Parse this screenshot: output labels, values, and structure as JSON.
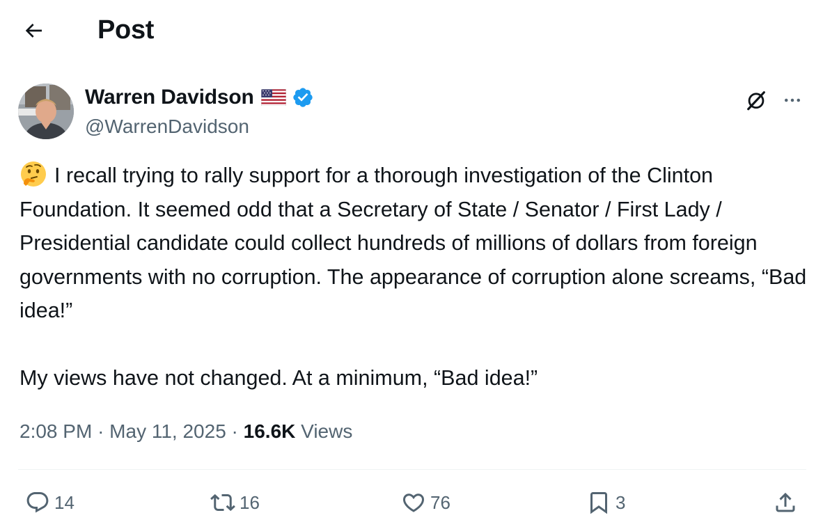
{
  "header": {
    "title": "Post",
    "back_icon": "arrow-left-icon"
  },
  "author": {
    "display_name": "Warren Davidson",
    "handle": "@WarrenDavidson",
    "flag_icon": "us-flag-icon",
    "verified_icon": "verified-badge-icon",
    "verified_color": "#1d9bf0"
  },
  "tweet": {
    "emoji": "thinking-face-emoji",
    "paragraph1": "I recall trying to rally support for a thorough investigation of the Clinton Foundation. It seemed odd that a Secretary of State / Senator / First Lady / Presidential candidate could collect hundreds of millions of dollars from foreign governments with no corruption. The appearance of corruption alone screams, “Bad idea!”",
    "paragraph2": "My views have not changed. At a minimum, “Bad idea!”"
  },
  "meta": {
    "time": "2:08 PM",
    "separator": "·",
    "date": "May 11, 2025",
    "views_count": "16.6K",
    "views_label": "Views"
  },
  "actions": {
    "replies": "14",
    "reposts": "16",
    "likes": "76",
    "bookmarks": "3"
  },
  "colors": {
    "text": "#0f1419",
    "secondary": "#536471",
    "divider": "#eff3f4",
    "accent": "#1d9bf0"
  }
}
